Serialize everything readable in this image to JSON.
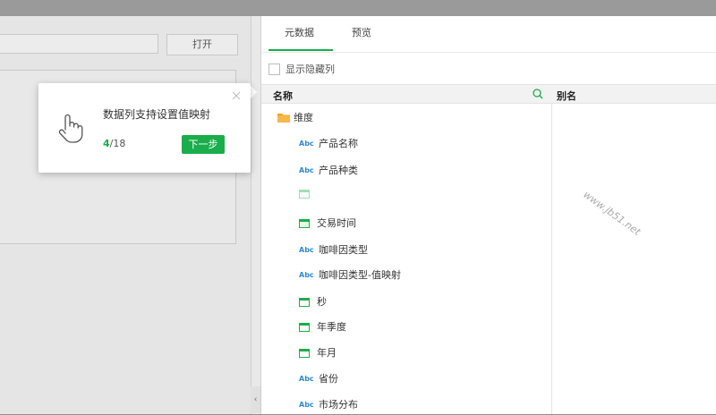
{
  "left": {
    "open_button": "打开"
  },
  "tabs": [
    {
      "label": "元数据"
    },
    {
      "label": "预览"
    }
  ],
  "show_hidden": {
    "label": "显示隐藏列",
    "checked": false
  },
  "table": {
    "col_name": "名称",
    "col_alias": "别名"
  },
  "tree": [
    {
      "label": "维度",
      "icon": "folder-icon"
    },
    {
      "label": "产品名称",
      "icon": "abc-icon"
    },
    {
      "label": "产品种类",
      "icon": "abc-icon"
    },
    {
      "label": "交易时间",
      "icon": "calendar-icon"
    },
    {
      "label": "咖啡因类型",
      "icon": "abc-icon"
    },
    {
      "label": "咖啡因类型-值映射",
      "icon": "abc-icon"
    },
    {
      "label": "秒",
      "icon": "calendar-icon"
    },
    {
      "label": "年季度",
      "icon": "calendar-icon"
    },
    {
      "label": "年月",
      "icon": "calendar-icon"
    },
    {
      "label": "省份",
      "icon": "abc-icon"
    },
    {
      "label": "市场分布",
      "icon": "abc-icon"
    }
  ],
  "abc_text": "Abc",
  "watermark": "www.jb51.net",
  "popover": {
    "message": "数据列支持设置值映射",
    "step_current": "4",
    "step_total": "/18",
    "next_label": "下一步"
  },
  "colors": {
    "accent": "#1aad4b",
    "abc": "#2a8bd9",
    "folder": "#f5a623"
  }
}
